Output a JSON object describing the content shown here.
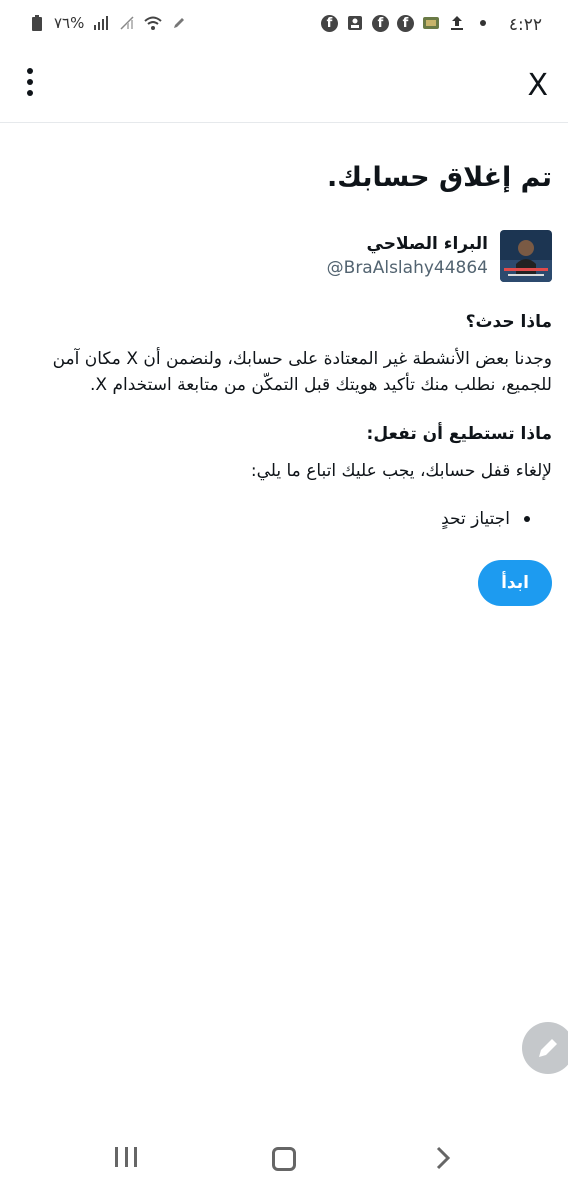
{
  "status_bar": {
    "time": "٤:٢٢",
    "battery": "%٧٦"
  },
  "header": {
    "close_label": "X"
  },
  "main": {
    "title": "تم إغلاق حسابك.",
    "account": {
      "name": "البراء الصلاحي",
      "handle": "@BraAlslahy44864"
    },
    "what_happened_heading": "ماذا حدث؟",
    "what_happened_text": "وجدنا بعض الأنشطة غير المعتادة على حسابك، ولنضمن أن X مكان آمن للجميع، نطلب منك تأكيد هويتك قبل التمكّن من متابعة استخدام X.",
    "what_you_can_do_heading": "ماذا تستطيع أن تفعل:",
    "what_you_can_do_text": "لإلغاء قفل حسابك، يجب عليك اتباع ما يلي:",
    "steps": [
      "اجتياز تحدٍ"
    ],
    "start_button": "ابدأ"
  },
  "colors": {
    "accent": "#1d9bf0",
    "text": "#0f1419",
    "secondary_text": "#536471"
  }
}
